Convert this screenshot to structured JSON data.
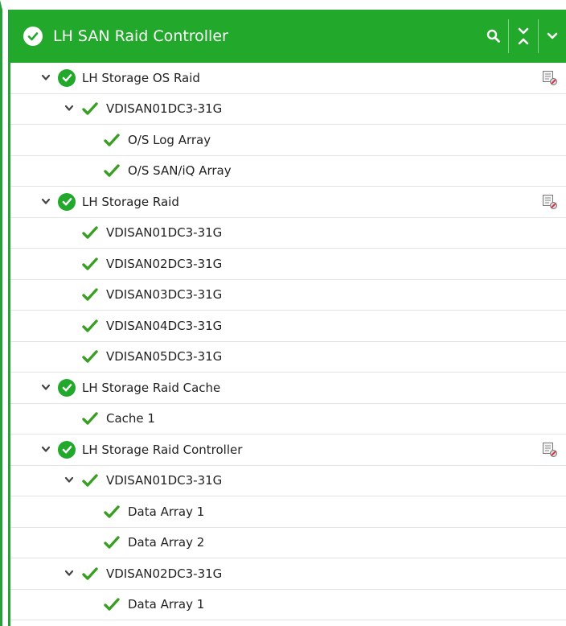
{
  "header": {
    "title": "LH SAN Raid Controller",
    "status_icon": "check-circle-icon"
  },
  "colors": {
    "accent": "#22a82a",
    "ok": "#3a9e22",
    "row_border": "#e4e4e4"
  },
  "tree": {
    "rows": [
      {
        "label": "LH Storage OS Raid"
      },
      {
        "label": "VDISAN01DC3-31G"
      },
      {
        "label": "O/S Log Array"
      },
      {
        "label": "O/S SAN/iQ Array"
      },
      {
        "label": "LH Storage Raid"
      },
      {
        "label": "VDISAN01DC3-31G"
      },
      {
        "label": "VDISAN02DC3-31G"
      },
      {
        "label": "VDISAN03DC3-31G"
      },
      {
        "label": "VDISAN04DC3-31G"
      },
      {
        "label": "VDISAN05DC3-31G"
      },
      {
        "label": "LH Storage Raid Cache"
      },
      {
        "label": "Cache 1"
      },
      {
        "label": "LH Storage Raid Controller"
      },
      {
        "label": "VDISAN01DC3-31G"
      },
      {
        "label": "Data Array 1"
      },
      {
        "label": "Data Array 2"
      },
      {
        "label": "VDISAN02DC3-31G"
      },
      {
        "label": "Data Array 1"
      }
    ]
  }
}
